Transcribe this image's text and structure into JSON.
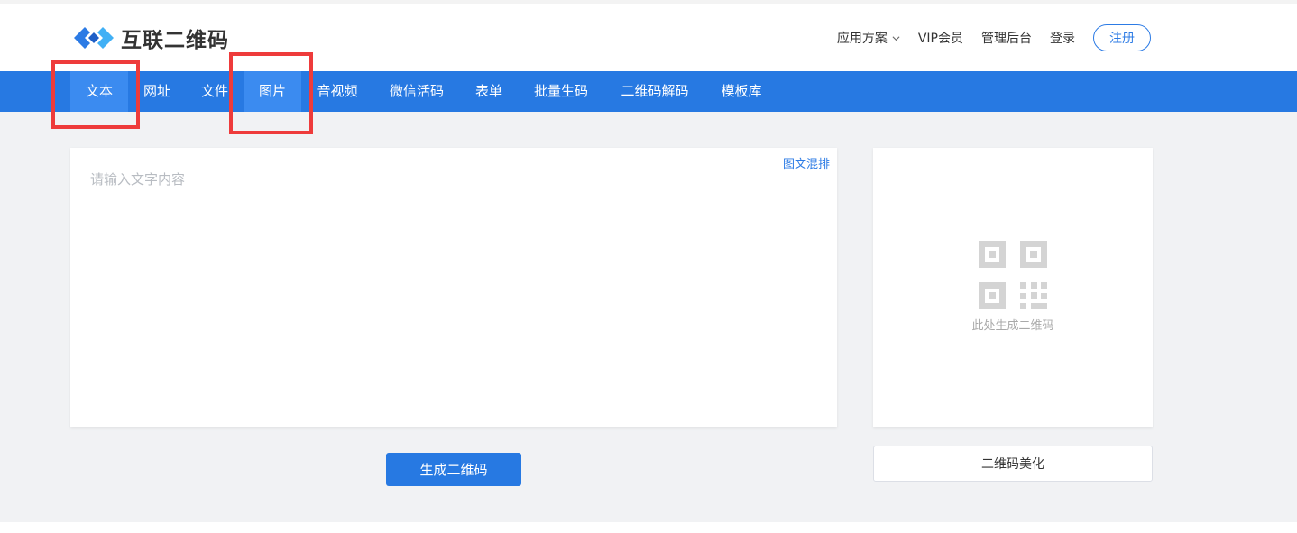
{
  "header": {
    "logo_text": "互联二维码",
    "nav": [
      {
        "label": "应用方案",
        "has_dropdown": true
      },
      {
        "label": "VIP会员",
        "has_dropdown": false
      },
      {
        "label": "管理后台",
        "has_dropdown": false
      },
      {
        "label": "登录",
        "has_dropdown": false
      }
    ],
    "register_label": "注册"
  },
  "tabs": [
    {
      "label": "文本",
      "active": true
    },
    {
      "label": "网址",
      "active": false
    },
    {
      "label": "文件",
      "active": false
    },
    {
      "label": "图片",
      "active": true
    },
    {
      "label": "音视频",
      "active": false
    },
    {
      "label": "微信活码",
      "active": false
    },
    {
      "label": "表单",
      "active": false
    },
    {
      "label": "批量生码",
      "active": false
    },
    {
      "label": "二维码解码",
      "active": false
    },
    {
      "label": "模板库",
      "active": false
    }
  ],
  "editor": {
    "placeholder": "请输入文字内容",
    "value": "",
    "mixed_link": "图文混排"
  },
  "generate_button": "生成二维码",
  "qr_panel": {
    "hint": "此处生成二维码",
    "icon": "qr-code-icon"
  },
  "beautify_button": "二维码美化",
  "colors": {
    "accent": "#2779e2",
    "nav_active": "#3b8bf0",
    "annotation": "#ee3b3b",
    "background": "#f1f2f4"
  }
}
